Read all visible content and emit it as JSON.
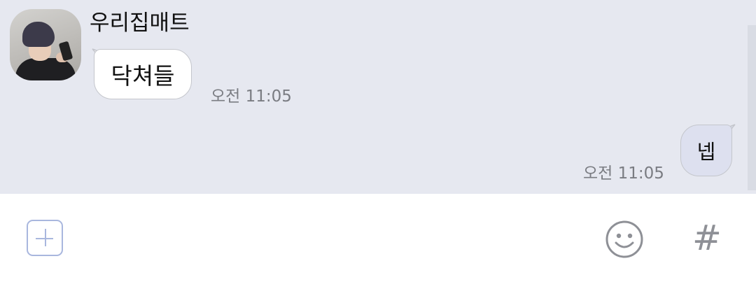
{
  "chat": {
    "incoming": {
      "sender": "우리집매트",
      "message": "닥쳐들",
      "time": "오전 11:05"
    },
    "outgoing": {
      "message": "넵",
      "time": "오전 11:05"
    }
  },
  "input_bar": {
    "icons": [
      "plus-icon",
      "emoji-icon",
      "hashtag-icon"
    ],
    "hashtag_glyph": "#"
  },
  "colors": {
    "chat_background": "#e6e8f0",
    "outgoing_bubble": "#dde0ef",
    "accent": "#a9b7de"
  }
}
